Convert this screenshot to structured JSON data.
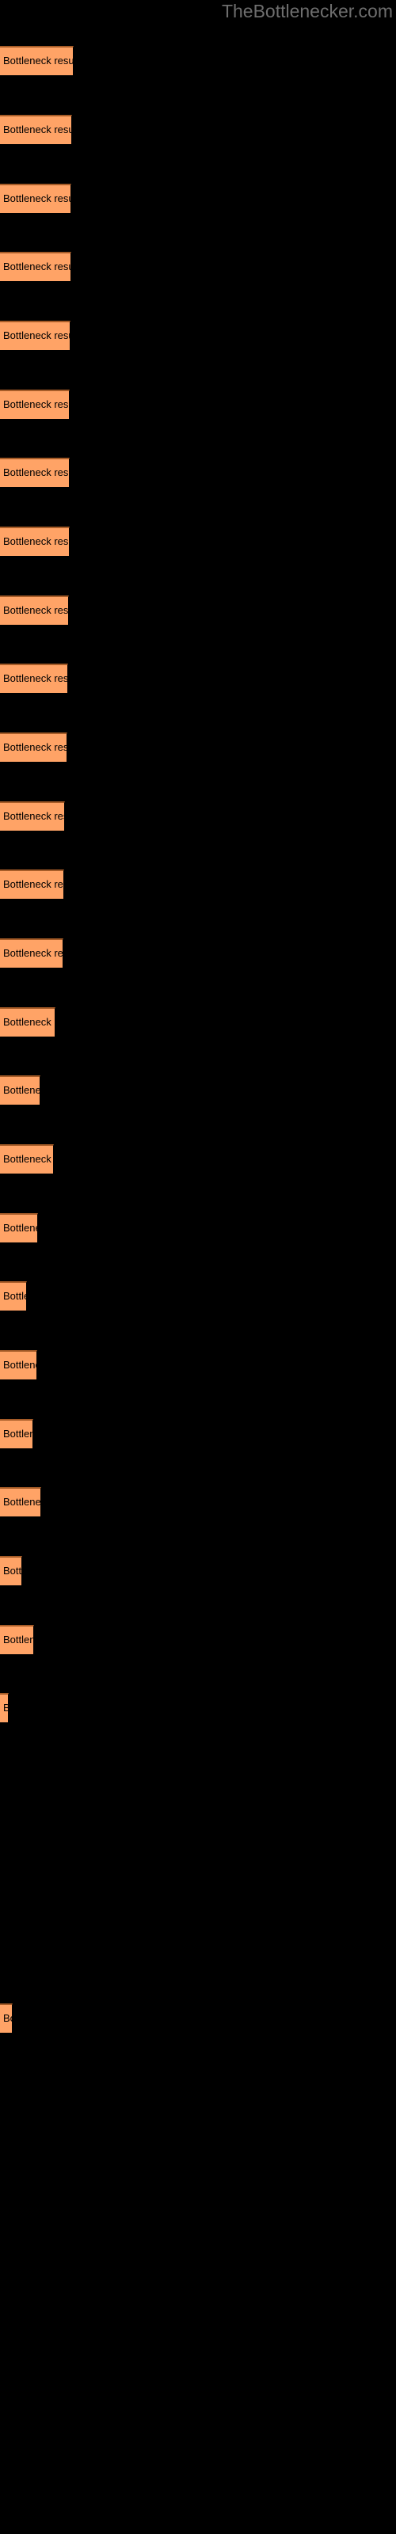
{
  "site": {
    "title": "TheBottlenecker.com",
    "title_color": "#6e6e6e"
  },
  "style": {
    "background": "#000000",
    "bar_fill": "#ffa366",
    "bar_top_border": "#a65c28",
    "label_color": "#000000"
  },
  "chart_data": {
    "type": "bar",
    "orientation": "horizontal",
    "title": "TheBottlenecker.com",
    "subtitle": "",
    "xlabel": "",
    "ylabel": "",
    "grid": false,
    "legend": null,
    "xlim": [
      0,
      500
    ],
    "bar_label": "Bottleneck result",
    "categories": [
      "Bottleneck result",
      "Bottleneck result",
      "Bottleneck result",
      "Bottleneck result",
      "Bottleneck result",
      "Bottleneck result",
      "Bottleneck result",
      "Bottleneck result",
      "Bottleneck result",
      "Bottleneck result",
      "Bottleneck result",
      "Bottleneck result",
      "Bottleneck result",
      "Bottleneck result",
      "Bottleneck result",
      "Bottleneck result",
      "Bottleneck result",
      "Bottleneck result",
      "Bottleneck result",
      "Bottleneck result",
      "Bottleneck result",
      "Bottleneck result",
      "Bottleneck result",
      "Bottleneck result",
      "Bottleneck result",
      "Bottleneck result"
    ],
    "values": [
      93,
      91,
      90,
      90,
      89,
      88,
      88,
      88,
      87,
      86,
      85,
      82,
      81,
      80,
      70,
      51,
      68,
      48,
      34,
      47,
      42,
      52,
      28,
      43,
      11,
      16
    ],
    "bars": [
      {
        "label": "Bottleneck result",
        "width": 93,
        "top": 58
      },
      {
        "label": "Bottleneck result",
        "width": 91,
        "top": 145
      },
      {
        "label": "Bottleneck result",
        "width": 90,
        "top": 232
      },
      {
        "label": "Bottleneck result",
        "width": 90,
        "top": 318
      },
      {
        "label": "Bottleneck result",
        "width": 89,
        "top": 405
      },
      {
        "label": "Bottleneck result",
        "width": 88,
        "top": 492
      },
      {
        "label": "Bottleneck result",
        "width": 88,
        "top": 578
      },
      {
        "label": "Bottleneck result",
        "width": 88,
        "top": 665
      },
      {
        "label": "Bottleneck result",
        "width": 87,
        "top": 752
      },
      {
        "label": "Bottleneck result",
        "width": 86,
        "top": 838
      },
      {
        "label": "Bottleneck result",
        "width": 85,
        "top": 925
      },
      {
        "label": "Bottleneck result",
        "width": 82,
        "top": 1012
      },
      {
        "label": "Bottleneck result",
        "width": 81,
        "top": 1098
      },
      {
        "label": "Bottleneck result",
        "width": 80,
        "top": 1185
      },
      {
        "label": "Bottleneck resu",
        "width": 70,
        "top": 1272
      },
      {
        "label": "Bottleneck",
        "width": 51,
        "top": 1358
      },
      {
        "label": "Bottleneck res",
        "width": 68,
        "top": 1445
      },
      {
        "label": "Bottlenec",
        "width": 48,
        "top": 1532
      },
      {
        "label": "Bottle",
        "width": 34,
        "top": 1618
      },
      {
        "label": "Bottlenec",
        "width": 47,
        "top": 1705
      },
      {
        "label": "Bottlene",
        "width": 42,
        "top": 1792
      },
      {
        "label": "Bottleneck r",
        "width": 52,
        "top": 1878
      },
      {
        "label": "Bottle",
        "width": 28,
        "top": 1965
      },
      {
        "label": "Bottlenec",
        "width": 43,
        "top": 2052
      },
      {
        "label": "B",
        "width": 11,
        "top": 2138
      },
      {
        "label": "Bo",
        "width": 16,
        "top": 2530
      }
    ]
  }
}
